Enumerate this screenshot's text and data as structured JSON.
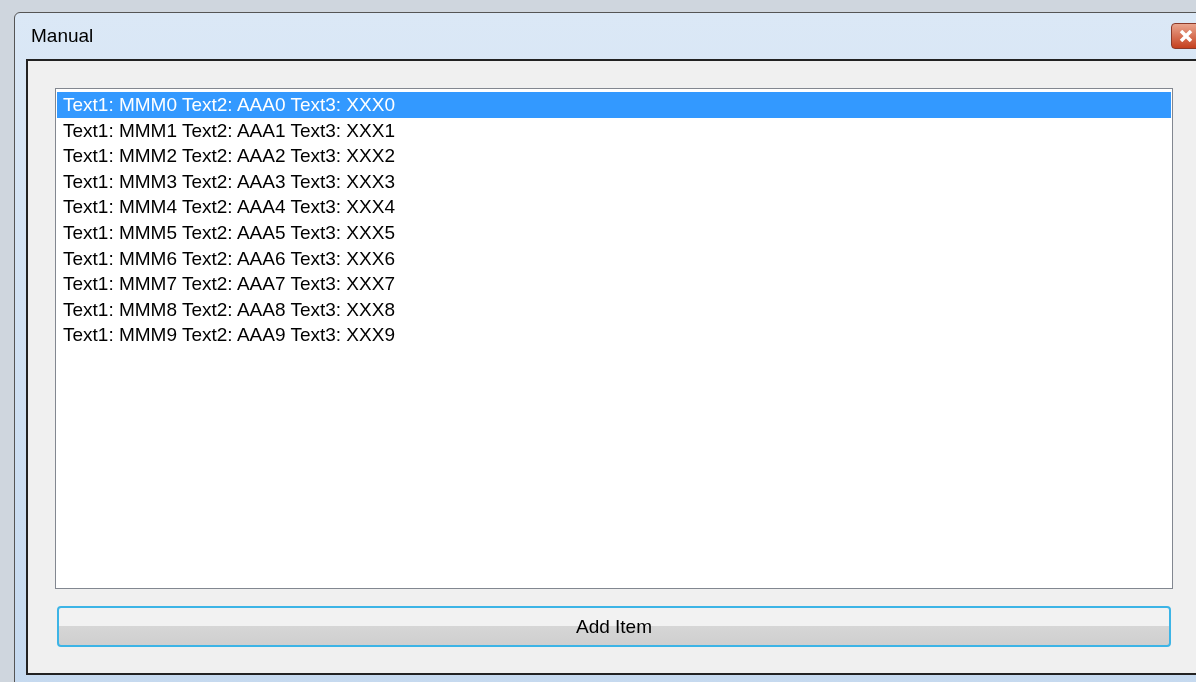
{
  "window": {
    "title": "Manual"
  },
  "list": {
    "items": [
      {
        "text": "Text1: MMM0 Text2: AAA0 Text3: XXX0",
        "selected": true
      },
      {
        "text": "Text1: MMM1 Text2: AAA1 Text3: XXX1",
        "selected": false
      },
      {
        "text": "Text1: MMM2 Text2: AAA2 Text3: XXX2",
        "selected": false
      },
      {
        "text": "Text1: MMM3 Text2: AAA3 Text3: XXX3",
        "selected": false
      },
      {
        "text": "Text1: MMM4 Text2: AAA4 Text3: XXX4",
        "selected": false
      },
      {
        "text": "Text1: MMM5 Text2: AAA5 Text3: XXX5",
        "selected": false
      },
      {
        "text": "Text1: MMM6 Text2: AAA6 Text3: XXX6",
        "selected": false
      },
      {
        "text": "Text1: MMM7 Text2: AAA7 Text3: XXX7",
        "selected": false
      },
      {
        "text": "Text1: MMM8 Text2: AAA8 Text3: XXX8",
        "selected": false
      },
      {
        "text": "Text1: MMM9 Text2: AAA9 Text3: XXX9",
        "selected": false
      }
    ]
  },
  "buttons": [
    "Add Item"
  ]
}
